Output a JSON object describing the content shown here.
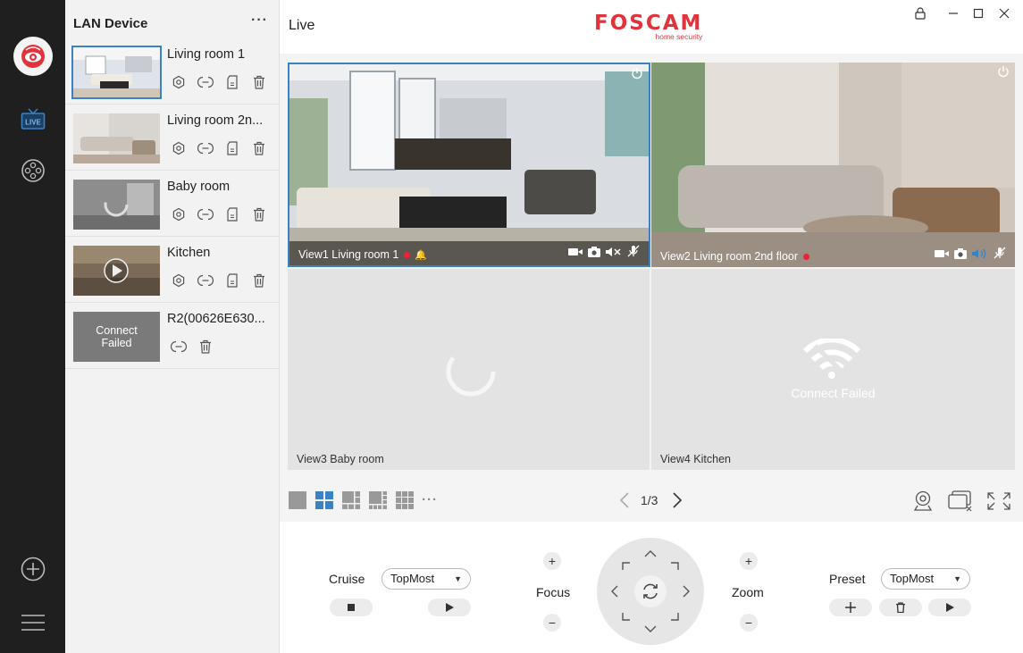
{
  "rail": {
    "items": [
      {
        "name": "foscam-logo-icon"
      },
      {
        "name": "live-icon",
        "label": "LIVE"
      },
      {
        "name": "playback-reel-icon"
      },
      {
        "name": "add-circle-icon"
      },
      {
        "name": "menu-icon"
      }
    ]
  },
  "device_panel": {
    "title": "LAN Device",
    "more": "···",
    "devices": [
      {
        "name": "Living room 1",
        "selected": true
      },
      {
        "name": "Living room 2n..."
      },
      {
        "name": "Baby room"
      },
      {
        "name": "Kitchen"
      },
      {
        "name": "R2(00626E630...",
        "thumb_text": "Connect Failed"
      }
    ]
  },
  "topbar": {
    "title": "Live",
    "brand": "FOSCAM",
    "brand_sub": "home security"
  },
  "views": [
    {
      "label": "View1 Living room 1"
    },
    {
      "label": "View2 Living room 2nd floor"
    },
    {
      "label": "View3 Baby room"
    },
    {
      "label": "View4  Kitchen",
      "status": "Connect Failed"
    }
  ],
  "toolbar": {
    "page": "1/3",
    "more": "···"
  },
  "ptz": {
    "cruise_label": "Cruise",
    "cruise_value": "TopMost",
    "focus_label": "Focus",
    "zoom_label": "Zoom",
    "preset_label": "Preset",
    "preset_value": "TopMost",
    "plus": "+",
    "minus": "−"
  },
  "colors": {
    "rail_bg": "#1f1f1f",
    "accent": "#3b82c4",
    "brand_red": "#e0333c",
    "rec_red": "#ee2233"
  }
}
